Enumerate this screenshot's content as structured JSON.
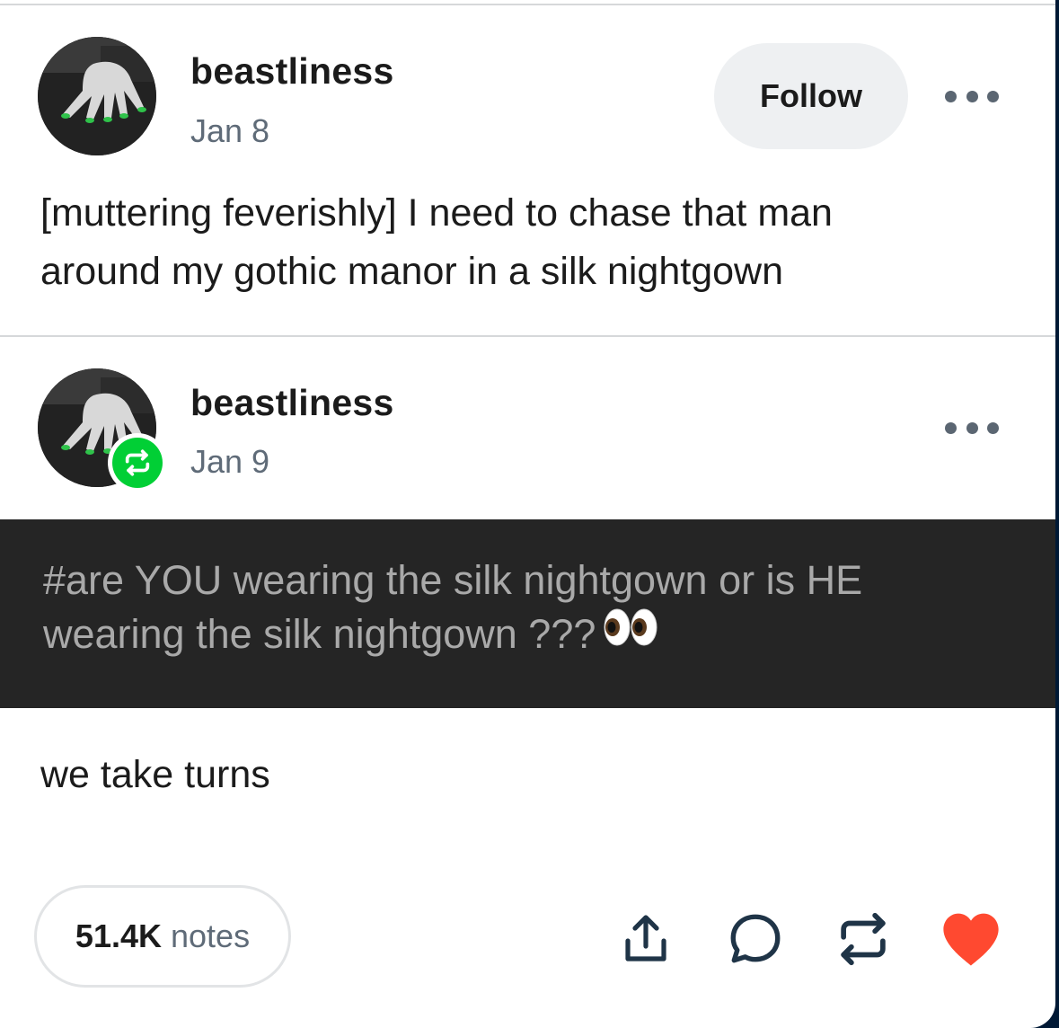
{
  "original_post": {
    "blog_name": "beastliness",
    "date": "Jan 8",
    "follow_label": "Follow",
    "text_line1": "[muttering feverishly] I need to chase that man",
    "text_line2": "around my gothic manor in a silk nightgown"
  },
  "reblog": {
    "blog_name": "beastliness",
    "date": "Jan 9",
    "tags_line1": "#are YOU wearing the silk nightgown or is HE",
    "tags_line2": "wearing the silk nightgown ???",
    "tags_emoji": "eyes-emoji",
    "comment": "we take turns"
  },
  "footer": {
    "notes_count": "51.4K",
    "notes_label": "notes",
    "actions": [
      "share-icon",
      "reply-icon",
      "reblog-icon",
      "like-icon"
    ]
  },
  "colors": {
    "like_active": "#ff4930",
    "reblog_green": "#01cf35",
    "tag_block_bg": "#252525",
    "page_bg": "#001935"
  }
}
